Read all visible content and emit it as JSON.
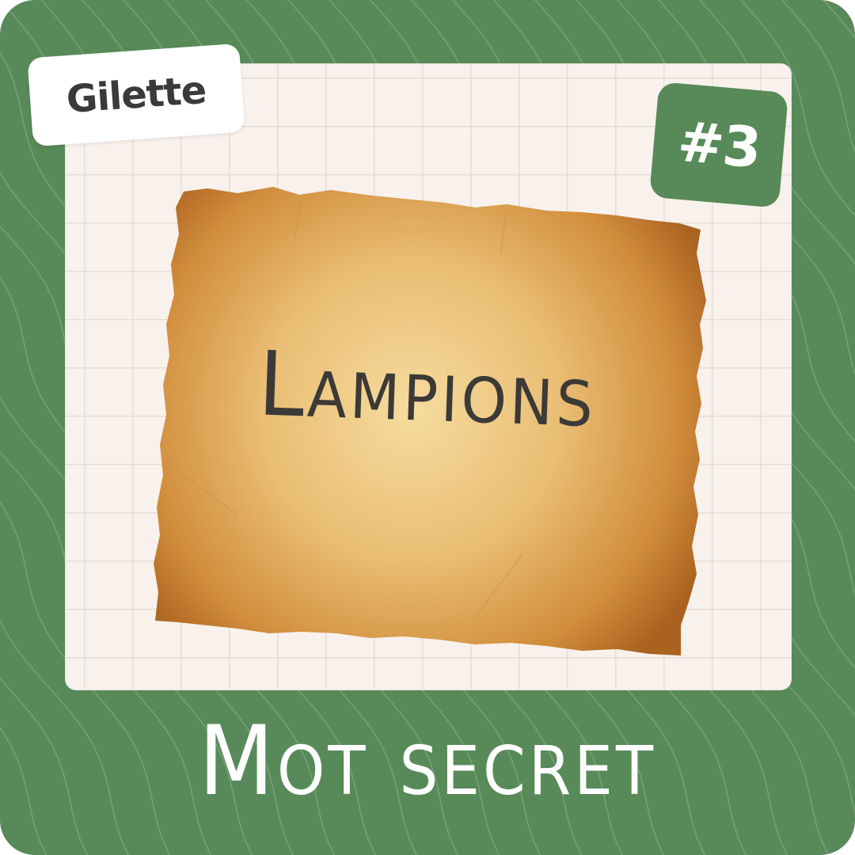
{
  "card": {
    "tag_label": "Gilette",
    "number_label": "#3",
    "secret_word": "Lampions",
    "footer_title": "Mot secret"
  },
  "colors": {
    "frame_green": "#578a58",
    "panel_background": "#f8f1ec",
    "grid_line": "#e6ddd8",
    "text_dark": "#3c3a37",
    "parchment_light": "#f3d494",
    "parchment_dark": "#b8712a"
  },
  "icons": {
    "background_pattern": "wave-lines-pattern",
    "parchment": "torn-parchment-paper"
  }
}
